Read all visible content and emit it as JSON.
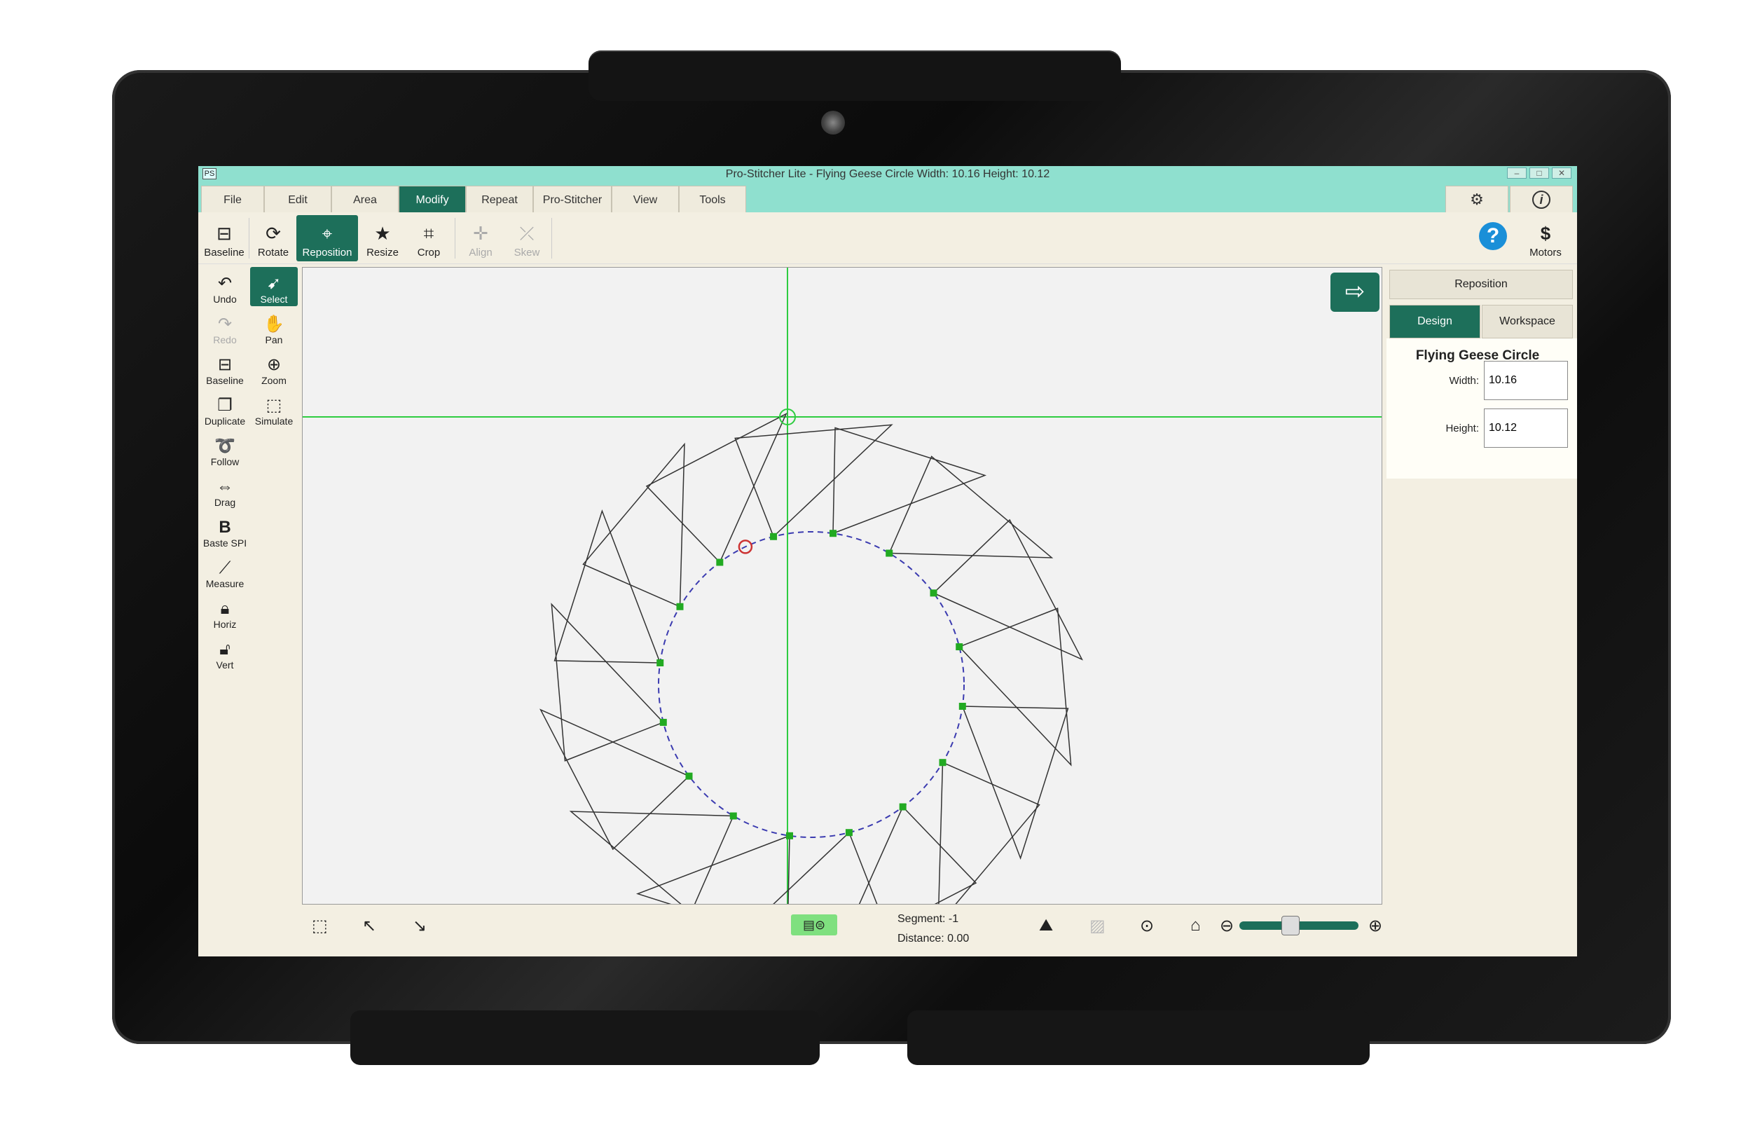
{
  "window": {
    "app_logo": "PS",
    "title": "Pro-Stitcher Lite  -  Flying Geese Circle    Width: 10.16   Height: 10.12",
    "buttons": [
      "minimize",
      "maximize",
      "close"
    ]
  },
  "menu_tabs": [
    {
      "label": "File",
      "active": false
    },
    {
      "label": "Edit",
      "active": false
    },
    {
      "label": "Area",
      "active": false
    },
    {
      "label": "Modify",
      "active": true
    },
    {
      "label": "Repeat",
      "active": false
    },
    {
      "label": "Pro-Stitcher",
      "active": false
    },
    {
      "label": "View",
      "active": false
    },
    {
      "label": "Tools",
      "active": false
    }
  ],
  "right_tabs": [
    {
      "name": "settings",
      "icon": "gear-icon"
    },
    {
      "name": "info",
      "icon": "info-icon"
    }
  ],
  "ribbon": {
    "items": [
      {
        "label": "Baseline",
        "icon": "baseline-icon",
        "state": "normal"
      },
      {
        "label": "Rotate",
        "icon": "rotate-icon",
        "state": "normal"
      },
      {
        "label": "Reposition",
        "icon": "crosshair-icon",
        "state": "active"
      },
      {
        "label": "Resize",
        "icon": "star-resize-icon",
        "state": "normal"
      },
      {
        "label": "Crop",
        "icon": "crop-icon",
        "state": "normal"
      },
      {
        "label": "Align",
        "icon": "align-icon",
        "state": "disabled"
      },
      {
        "label": "Skew",
        "icon": "skew-icon",
        "state": "disabled"
      }
    ],
    "help": "?",
    "motors_label": "Motors",
    "motors_icon": "$"
  },
  "left_tools": [
    {
      "label": "Undo",
      "icon": "undo-icon",
      "state": "normal"
    },
    {
      "label": "Select",
      "icon": "select-arrow-icon",
      "state": "active"
    },
    {
      "label": "Redo",
      "icon": "redo-icon",
      "state": "disabled"
    },
    {
      "label": "Pan",
      "icon": "hand-icon",
      "state": "normal"
    },
    {
      "label": "Baseline",
      "icon": "baseline-icon",
      "state": "normal"
    },
    {
      "label": "Zoom",
      "icon": "zoom-icon",
      "state": "normal"
    },
    {
      "label": "Duplicate",
      "icon": "duplicate-icon",
      "state": "normal"
    },
    {
      "label": "Simulate",
      "icon": "simulate-icon",
      "state": "normal"
    },
    {
      "label": "Follow",
      "icon": "follow-icon",
      "state": "normal"
    },
    {
      "label": "Drag",
      "icon": "drag-icon",
      "state": "normal"
    },
    {
      "label": "Baste SPI",
      "icon": "baste-icon",
      "state": "normal"
    },
    {
      "label": "Measure",
      "icon": "measure-icon",
      "state": "normal"
    },
    {
      "label": "Horiz",
      "icon": "lock-horiz-icon",
      "state": "normal"
    },
    {
      "label": "Vert",
      "icon": "lock-vert-icon",
      "state": "normal"
    }
  ],
  "canvas": {
    "design_name": "Flying Geese Circle",
    "triangle_count": 16,
    "colors": {
      "crosshair": "#2ecc40",
      "dashed_path": "#3b3bb0",
      "node": "#22aa22",
      "start_node": "#cc3333",
      "outline": "#333333"
    }
  },
  "right_panel": {
    "header": "Reposition",
    "tabs": [
      {
        "label": "Design",
        "active": true
      },
      {
        "label": "Workspace",
        "active": false
      }
    ],
    "design_name": "Flying Geese Circle",
    "width_label": "Width:",
    "width_value": "10.16",
    "height_label": "Height:",
    "height_value": "10.12"
  },
  "status": {
    "segment_label": "Segment: -1",
    "distance_label": "Distance: 0.00",
    "zoom_level_fraction": 0.42
  },
  "colors": {
    "accent": "#1d6f5a",
    "title_bar": "#8fe0cf",
    "background": "#f3efe2"
  }
}
